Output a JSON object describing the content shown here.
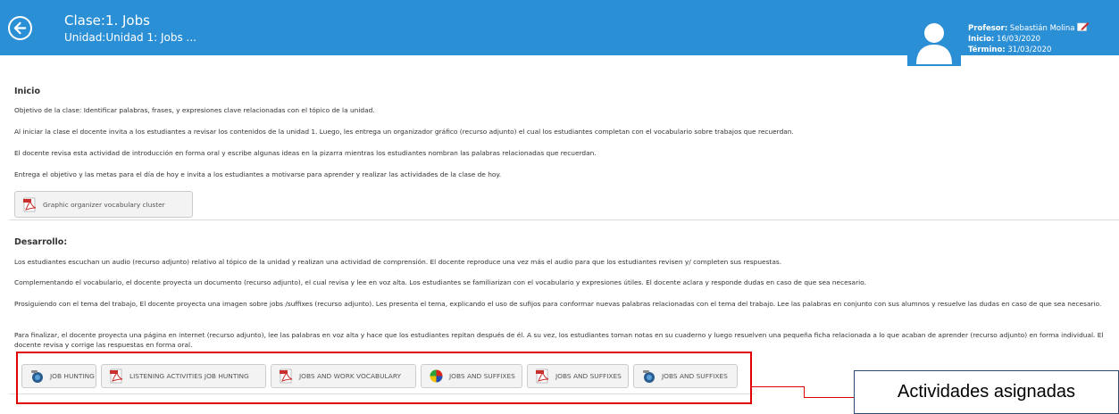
{
  "header": {
    "title": "Clase:1. Jobs",
    "subtitle": "Unidad:Unidad 1: Jobs ...",
    "profesor_label": "Profesor:",
    "profesor_name": "Sebastián Molina",
    "inicio_label": "Inicio:",
    "inicio_date": "16/03/2020",
    "termino_label": "Término:",
    "termino_date": "31/03/2020",
    "color": "#2b8fd6"
  },
  "inicio": {
    "title": "Inicio",
    "paragraphs": [
      "Objetivo de la clase: Identificar palabras, frases,  y expresiones clave relacionadas con el tópico de la unidad.",
      "Al iniciar la clase el docente invita a los estudiantes a revisar los contenidos de la unidad 1. Luego, les entrega un organizador gráfico (recurso adjunto) el cual los estudiantes completan con el vocabulario sobre trabajos que recuerdan.",
      "El docente revisa esta actividad de introducción en forma oral y escribe algunas ideas en la pizarra mientras los estudiantes nombran las palabras relacionadas que recuerdan.",
      "Entrega el objetivo y las metas para el día de hoy e invita a los estudiantes a motivarse para aprender y realizar las actividades de la clase de hoy."
    ],
    "resource": {
      "label": "Graphic organizer vocabulary cluster",
      "icon": "pdf-icon"
    }
  },
  "desarrollo": {
    "title": "Desarrollo:",
    "paragraphs": [
      "Los estudiantes escuchan un audio (recurso adjunto) relativo al tópico de la unidad y realizan una actividad de comprensión. El docente reproduce una vez más el audio para que los estudiantes revisen y/ completen sus respuestas.",
      "Complementando el vocabulario, el docente proyecta un documento (recurso adjunto), el cual revisa y lee en voz alta. Los estudiantes se familiarizan con el vocabulario y expresiones útiles. El docente aclara y responde dudas en caso de que sea necesario.",
      "Prosiguiendo con el tema del trabajo, El docente proyecta una imagen sobre jobs /suffixes (recurso adjunto). Les presenta el tema, explicando el uso de sufijos para conformar nuevas palabras relacionadas con el tema del trabajo. Lee las palabras en conjunto con sus alumnos y resuelve las dudas en caso de que sea necesario.",
      "Para finalizar, el docente proyecta una página en internet  (recurso adjunto), lee las palabras  en voz alta y hace que los estudiantes repitan después de él. A su vez, los estudiantes toman notas en su cuaderno y luego resuelven una pequeña ficha relacionada a lo que acaban de aprender (recurso adjunto) en forma individual. El docente revisa y corrige las respuestas en forma oral."
    ],
    "resources": [
      {
        "label": "JOB HUNTING",
        "icon": "audio-icon"
      },
      {
        "label": "LISTENING ACTIVITIES JOB HUNTING",
        "icon": "pdf-icon"
      },
      {
        "label": "JOBS AND WORK VOCABULARY",
        "icon": "pdf-icon"
      },
      {
        "label": "JOBS AND SUFFIXES",
        "icon": "image-icon"
      },
      {
        "label": "JOBS AND SUFFIXES",
        "icon": "pdf-icon"
      },
      {
        "label": "JOBS AND SUFFIXES",
        "icon": "web-icon"
      }
    ]
  },
  "annotation": {
    "label": "Actividades asignadas",
    "highlight_color": "#e00000"
  }
}
